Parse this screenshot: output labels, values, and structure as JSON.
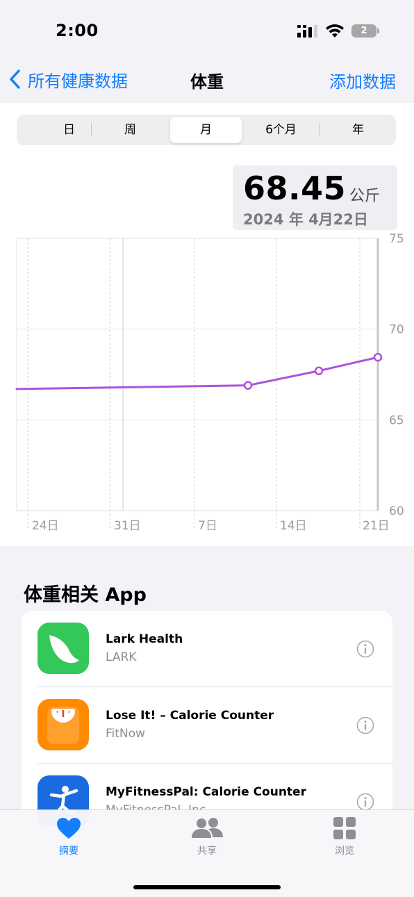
{
  "status_bar": {
    "time": "2:00",
    "battery_level": "2"
  },
  "nav": {
    "back_label": "所有健康数据",
    "title": "体重",
    "action_label": "添加数据"
  },
  "segments": {
    "items": [
      "日",
      "周",
      "月",
      "6个月",
      "年"
    ],
    "selected": "月"
  },
  "readout": {
    "value": "68.45",
    "unit": "公斤",
    "date": "2024 年 4月22日"
  },
  "chart_data": {
    "type": "line",
    "x_tick_labels": [
      "24日",
      "31日",
      "7日",
      "14日",
      "21日"
    ],
    "y_tick_labels": [
      "75",
      "70",
      "65",
      "60"
    ],
    "ylim": [
      60,
      75
    ],
    "points": [
      {
        "date": "3月21日",
        "value": 66.7
      },
      {
        "date": "4月10日",
        "value": 66.9
      },
      {
        "date": "4月17日",
        "value": 67.7
      },
      {
        "date": "4月22日",
        "value": 68.45
      }
    ],
    "line_color": "#af52de",
    "grid": true
  },
  "related_apps": {
    "title": "体重相关 App",
    "items": [
      {
        "name": "Lark Health",
        "developer": "LARK",
        "icon": "lark-bird-icon",
        "color": "#34c759"
      },
      {
        "name": "Lose It! – Calorie Counter",
        "developer": "FitNow",
        "icon": "scale-icon",
        "color": "#ff8a00"
      },
      {
        "name": "MyFitnessPal: Calorie Counter",
        "developer": "MyFitnessPal, Inc.",
        "icon": "runner-icon",
        "color": "#1a6ae0"
      }
    ]
  },
  "tab_bar": {
    "items": [
      {
        "label": "摘要",
        "icon": "heart-icon",
        "active": true
      },
      {
        "label": "共享",
        "icon": "people-icon",
        "active": false
      },
      {
        "label": "浏览",
        "icon": "grid-icon",
        "active": false
      }
    ],
    "active_color": "#147efb",
    "inactive_color": "#8e8e93"
  }
}
